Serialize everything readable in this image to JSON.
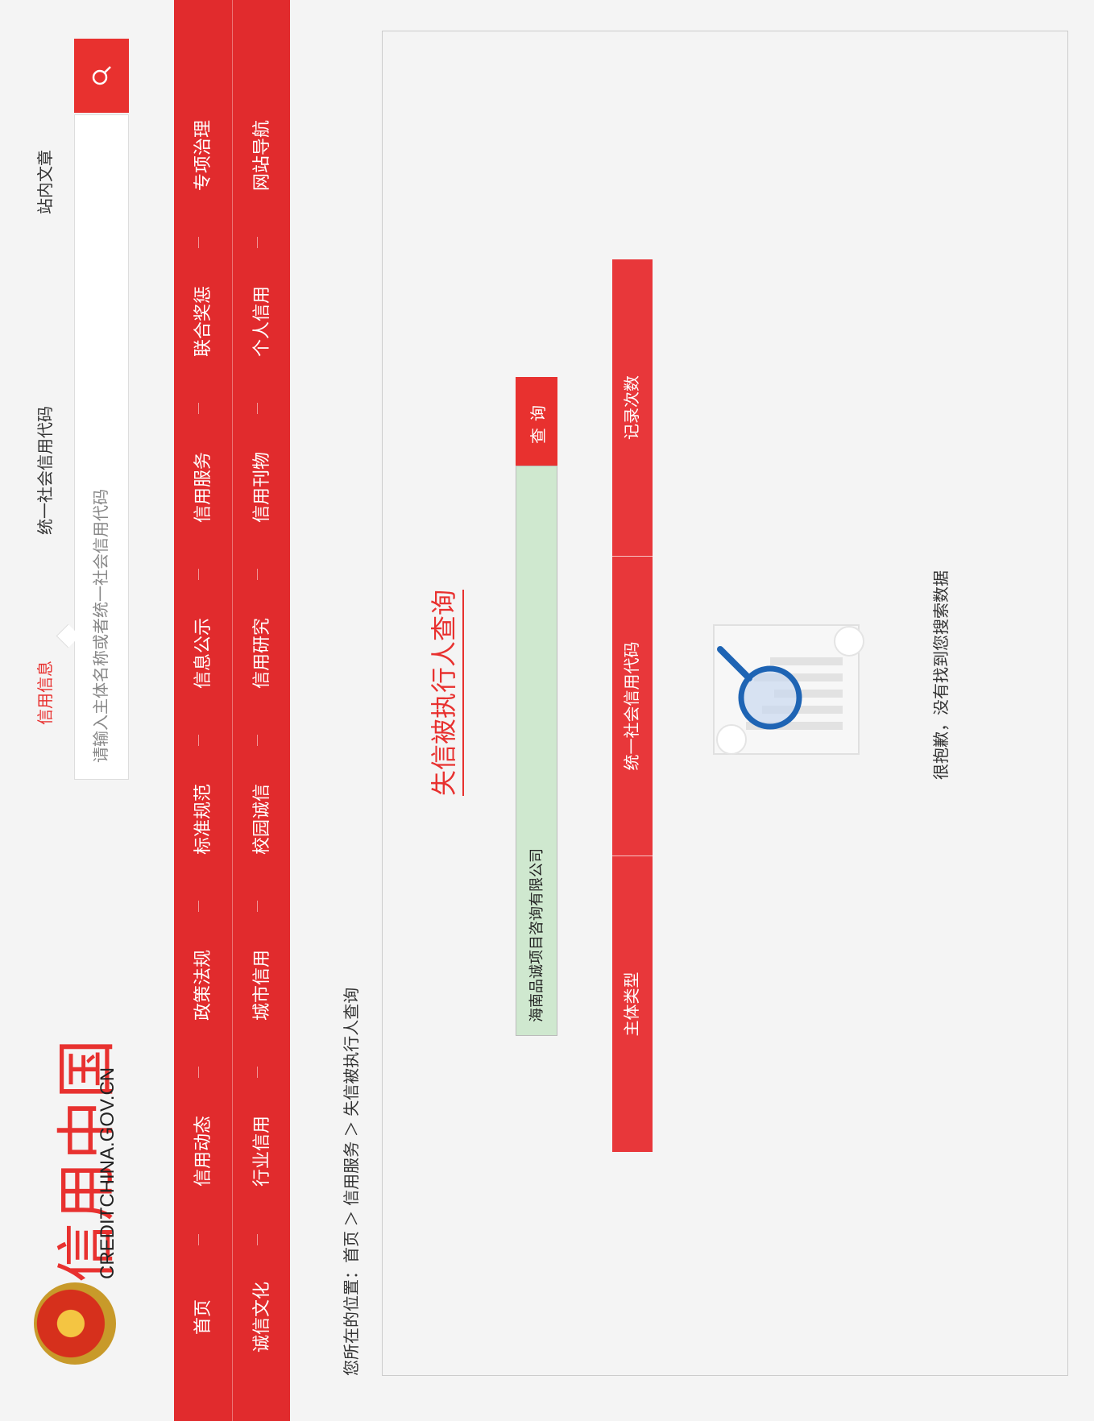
{
  "header": {
    "logo_cn": "信用中国",
    "logo_en": "CREDITCHINA.GOV.CN",
    "search_tabs": [
      "信用信息",
      "统一社会信用代码",
      "站内文章"
    ],
    "active_tab": 0,
    "search_placeholder": "请输入主体名称或者统一社会信用代码"
  },
  "nav": {
    "row1": [
      "首页",
      "信用动态",
      "政策法规",
      "标准规范",
      "信息公示",
      "信用服务",
      "联合奖惩",
      "专项治理"
    ],
    "row2": [
      "诚信文化",
      "行业信用",
      "城市信用",
      "校园诚信",
      "信用研究",
      "信用刊物",
      "个人信用",
      "网站导航"
    ]
  },
  "breadcrumb": "您所在的位置：首页 ＞ 信用服务 ＞ 失信被执行人查询",
  "main": {
    "title": "失信被执行人查询",
    "query_value": "海南品诚项目咨询有限公司",
    "query_button": "查询",
    "columns": [
      "主体类型",
      "统一社会信用代码",
      "记录次数"
    ],
    "empty_message": "很抱歉，没有找到您搜索数据"
  },
  "colors": {
    "brand_red": "#e12b2d",
    "input_bg": "#cfe8cf"
  }
}
